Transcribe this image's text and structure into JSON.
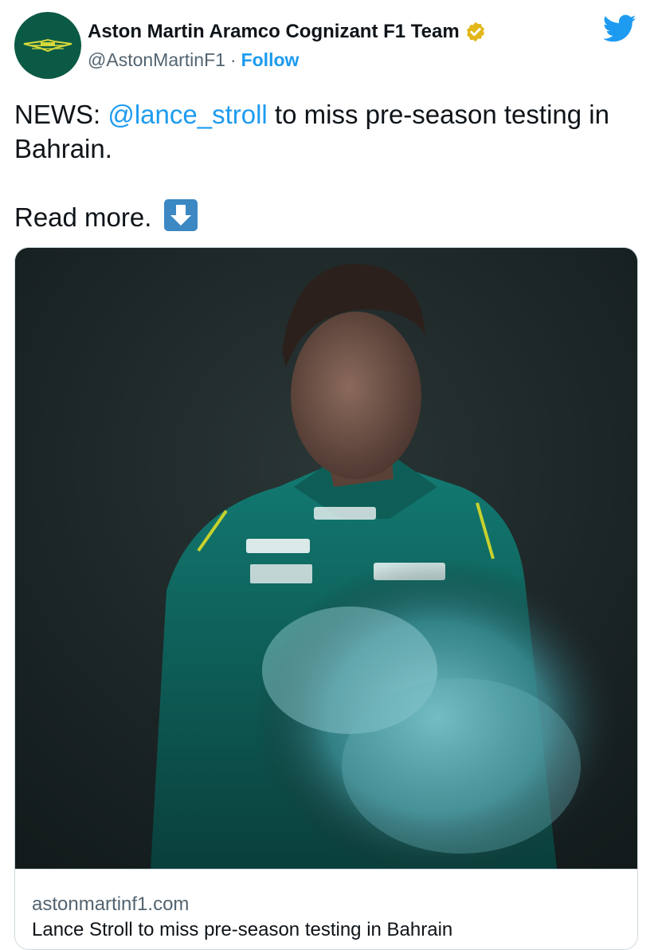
{
  "header": {
    "display_name": "Aston Martin Aramco Cognizant F1 Team",
    "handle": "@AstonMartinF1",
    "separator": "·",
    "follow_label": "Follow",
    "avatar_icon": "aston-martin-wings-logo",
    "verified_icon": "verified-badge-icon",
    "verified_color": "#e2b719",
    "platform_icon": "twitter-bird-icon",
    "platform_color": "#1d9bf0"
  },
  "tweet": {
    "prefix": "NEWS: ",
    "mention": "@lance_stroll",
    "after_mention": " to miss pre-season testing in",
    "line2": "Bahrain.",
    "line3": "Read more.",
    "emoji": "down-arrow-emoji"
  },
  "card": {
    "image_alt": "Driver in green Aston Martin race suit looking down",
    "domain": "astonmartinf1.com",
    "title": "Lance Stroll to miss pre-season testing in Bahrain"
  },
  "colors": {
    "accent": "#1d9bf0",
    "brand_green": "#0b5a45",
    "suit_teal": "#0d6e64"
  }
}
